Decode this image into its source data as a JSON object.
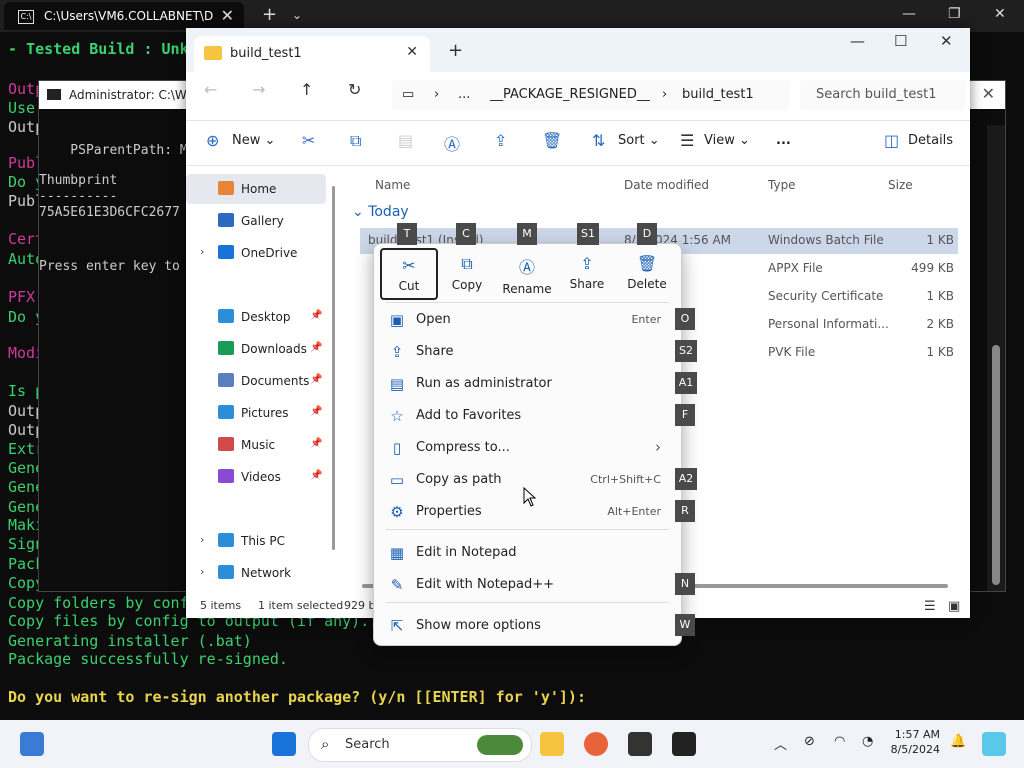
{
  "terminal": {
    "tab_title": "C:\\Users\\VM6.COLLABNET\\Dc",
    "tab_icon": "terminal-icon",
    "lines": [
      {
        "text": "- Tested Build : Unk",
        "color": "#3bd16f"
      },
      {
        "text": "Outp",
        "color": "#d03a9a"
      },
      {
        "text": "Use",
        "color": "#3bd16f"
      },
      {
        "text": "Outp",
        "color": "#cccccc"
      },
      {
        "text": "Publ",
        "color": "#d03a9a"
      },
      {
        "text": "Do y",
        "color": "#3bd16f"
      },
      {
        "text": "Publ",
        "color": "#cccccc"
      },
      {
        "text": "Cert",
        "color": "#d03a9a"
      },
      {
        "text": "Auto",
        "color": "#3bd16f"
      },
      {
        "text": "PFX",
        "color": "#d03a9a"
      },
      {
        "text": "Do y",
        "color": "#3bd16f"
      },
      {
        "text": "Modi",
        "color": "#d03a9a"
      },
      {
        "text": "Is p",
        "color": "#3bd16f"
      },
      {
        "text": "Outp",
        "color": "#cccccc"
      },
      {
        "text": "Outp",
        "color": "#cccccc"
      },
      {
        "text": "Extr",
        "color": "#3bd16f"
      },
      {
        "text": "Gene",
        "color": "#3bd16f"
      },
      {
        "text": "Gene",
        "color": "#3bd16f"
      },
      {
        "text": "Gene",
        "color": "#3bd16f"
      },
      {
        "text": "Maki",
        "color": "#3bd16f"
      },
      {
        "text": "Sign",
        "color": "#3bd16f"
      },
      {
        "text": "Pack",
        "color": "#3bd16f"
      },
      {
        "text": "Copy",
        "color": "#3bd16f"
      },
      {
        "text": "Copy folders by conf",
        "color": "#3bd16f"
      },
      {
        "text": "Copy files by config to output (if any)...",
        "color": "#3bd16f"
      },
      {
        "text": "Generating installer (.bat)",
        "color": "#3bd16f"
      },
      {
        "text": "Package successfully re-signed.",
        "color": "#3bd16f"
      },
      {
        "text": "",
        "color": "#3bd16f"
      },
      {
        "text": "Do you want to re-sign another package? (y/n [[ENTER] for 'y']):",
        "color": "#e8d44d"
      }
    ]
  },
  "admin_window": {
    "title": "Administrator: C:\\WIN",
    "lines": [
      "",
      "    PSParentPath: Mi",
      "",
      "Thumbprint",
      "----------",
      "75A5E61E3D6CFC2677",
      "",
      "",
      "Press enter key to"
    ]
  },
  "explorer": {
    "tab_label": "build_test1",
    "breadcrumb": [
      "...",
      "__PACKAGE_RESIGNED__",
      "build_test1"
    ],
    "search_placeholder": "Search build_test1",
    "toolbar": {
      "new": "New",
      "sort": "Sort",
      "view": "View",
      "more": "...",
      "details": "Details"
    },
    "nav": [
      {
        "label": "Home",
        "icon": "home-icon",
        "color": "#e8833a",
        "pinned": false,
        "selected": true
      },
      {
        "label": "Gallery",
        "icon": "gallery-icon",
        "color": "#2a6bbf",
        "pinned": false
      },
      {
        "label": "OneDrive",
        "icon": "onedrive-icon",
        "color": "#1a73d9",
        "pinned": false,
        "expandable": true
      },
      {
        "label": "Desktop",
        "icon": "desktop-icon",
        "color": "#2a8fd6",
        "pinned": true
      },
      {
        "label": "Downloads",
        "icon": "downloads-icon",
        "color": "#1a9b5a",
        "pinned": true
      },
      {
        "label": "Documents",
        "icon": "documents-icon",
        "color": "#5a7fbf",
        "pinned": true
      },
      {
        "label": "Pictures",
        "icon": "pictures-icon",
        "color": "#2a8fd6",
        "pinned": true
      },
      {
        "label": "Music",
        "icon": "music-icon",
        "color": "#d34a4a",
        "pinned": true
      },
      {
        "label": "Videos",
        "icon": "videos-icon",
        "color": "#8a4ad3",
        "pinned": true
      },
      {
        "label": "This PC",
        "icon": "this-pc-icon",
        "color": "#2a8fd6",
        "pinned": false,
        "expandable": true
      },
      {
        "label": "Network",
        "icon": "network-icon",
        "color": "#2a8fd6",
        "pinned": false,
        "expandable": true
      }
    ],
    "columns": {
      "name": "Name",
      "date": "Date modified",
      "type": "Type",
      "size": "Size"
    },
    "group": "Today",
    "files": [
      {
        "name": "build_test1 (Install)",
        "date": "8/5/2024 1:56 AM",
        "type": "Windows Batch File",
        "size": "1 KB",
        "selected": true
      },
      {
        "name": "",
        "date": "56 AM",
        "type": "APPX File",
        "size": "499 KB"
      },
      {
        "name": "",
        "date": "56 AM",
        "type": "Security Certificate",
        "size": "1 KB"
      },
      {
        "name": "",
        "date": "AM",
        "type": "Personal Informati...",
        "size": "2 KB"
      },
      {
        "name": "",
        "date": "AM",
        "type": "PVK File",
        "size": "1 KB"
      }
    ],
    "status": {
      "items": "5 items",
      "selected": "1 item selected",
      "size": "929 by"
    }
  },
  "context_menu": {
    "quick_actions": [
      {
        "label": "Cut",
        "icon": "cut-icon",
        "key": "T",
        "active": true
      },
      {
        "label": "Copy",
        "icon": "copy-icon",
        "key": "C"
      },
      {
        "label": "Rename",
        "icon": "rename-icon",
        "key": "M"
      },
      {
        "label": "Share",
        "icon": "share-icon",
        "key": "S1"
      },
      {
        "label": "Delete",
        "icon": "delete-icon",
        "key": "D"
      }
    ],
    "items": [
      {
        "label": "Open",
        "shortcut": "Enter",
        "icon": "open-icon",
        "key": "O"
      },
      {
        "label": "Share",
        "shortcut": "",
        "icon": "share-icon",
        "key": "S2"
      },
      {
        "label": "Run as administrator",
        "shortcut": "",
        "icon": "shield-icon",
        "key": "A1"
      },
      {
        "label": "Add to Favorites",
        "shortcut": "",
        "icon": "star-icon",
        "key": "F"
      },
      {
        "label": "Compress to...",
        "shortcut": "",
        "icon": "zip-icon",
        "key": "",
        "submenu": true
      },
      {
        "label": "Copy as path",
        "shortcut": "Ctrl+Shift+C",
        "icon": "path-icon",
        "key": "A2"
      },
      {
        "label": "Properties",
        "shortcut": "Alt+Enter",
        "icon": "wrench-icon",
        "key": "R"
      },
      {
        "label": "Edit in Notepad",
        "shortcut": "",
        "icon": "notepad-icon",
        "key": ""
      },
      {
        "label": "Edit with Notepad++",
        "shortcut": "",
        "icon": "notepadpp-icon",
        "key": "N"
      },
      {
        "label": "Show more options",
        "shortcut": "",
        "icon": "more-options-icon",
        "key": "W"
      }
    ]
  },
  "taskbar": {
    "search_label": "Search",
    "time": "1:57 AM",
    "date": "8/5/2024"
  }
}
